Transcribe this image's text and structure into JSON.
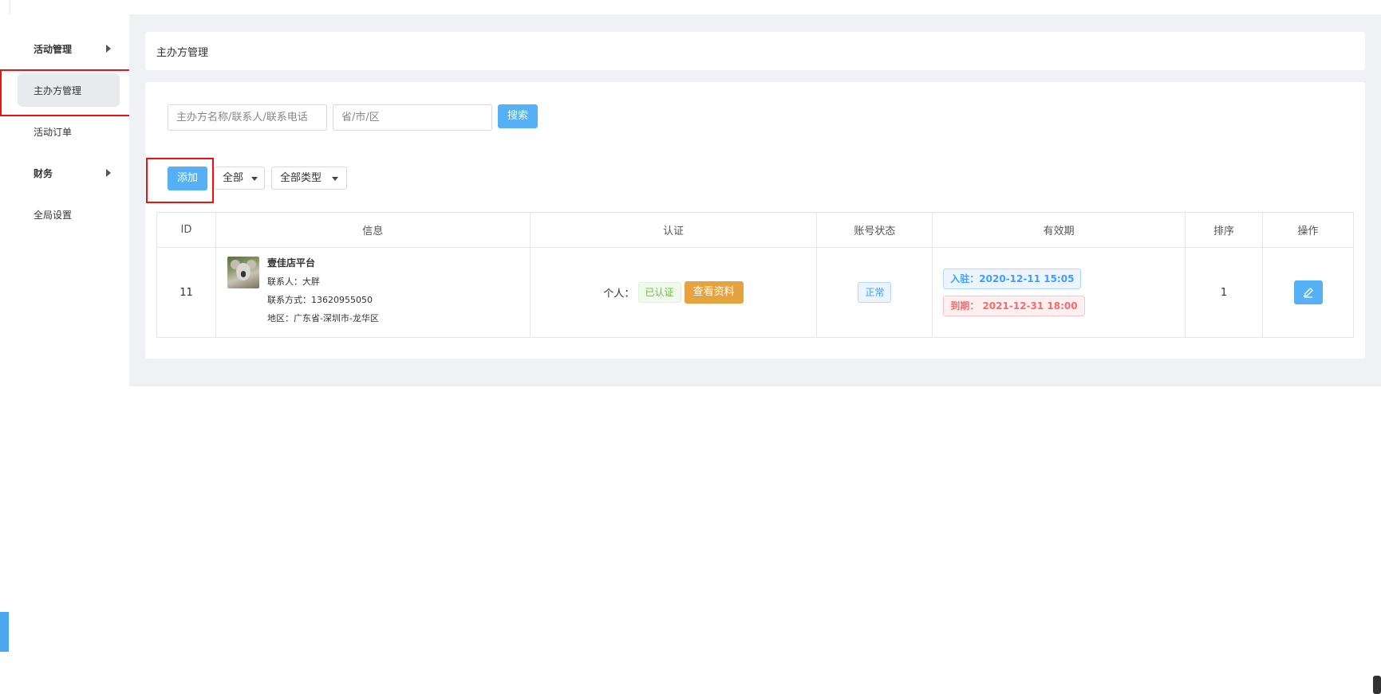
{
  "sidebar": {
    "items": [
      {
        "label": "活动管理",
        "bold": true,
        "has_arrow": true
      },
      {
        "label": "主办方管理",
        "bold": false,
        "active": true
      },
      {
        "label": "活动订单",
        "bold": false
      },
      {
        "label": "财务",
        "bold": true,
        "has_arrow": true
      },
      {
        "label": "全局设置",
        "bold": false
      }
    ]
  },
  "header": {
    "title": "主办方管理"
  },
  "search": {
    "keyword_placeholder": "主办方名称/联系人/联系电话",
    "region_placeholder": "省/市/区",
    "search_label": "搜索"
  },
  "toolbar": {
    "add_label": "添加",
    "filter_status": "全部",
    "filter_type": "全部类型"
  },
  "table": {
    "columns": [
      "ID",
      "信息",
      "认证",
      "账号状态",
      "有效期",
      "排序",
      "操作"
    ],
    "rows": [
      {
        "id": "11",
        "name": "壹佳店平台",
        "contact": "联系人：大胖",
        "phone": "联系方式：13620955050",
        "region": "地区：广东省-深圳市-龙华区",
        "cert_label": "个人：",
        "cert_status": "已认证",
        "view_label": "查看资料",
        "account_status": "正常",
        "join_date": "入驻：2020-12-11 15:05",
        "expire_date": "到期： 2021-12-31 18:00",
        "sort": "1"
      }
    ]
  },
  "colors": {
    "accent": "#55b0f5",
    "highlight_box": "#ee1111",
    "warning": "#e6a23c"
  },
  "icons": {
    "edit": "edit-icon",
    "avatar": "koala-avatar"
  }
}
